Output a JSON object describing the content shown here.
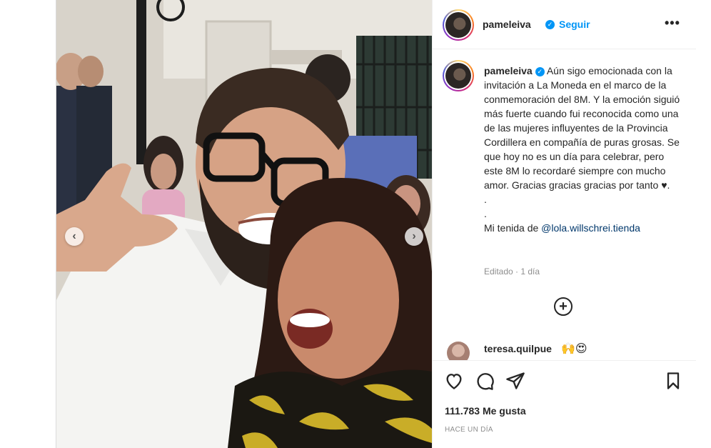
{
  "header": {
    "username": "pameleiva",
    "verified_icon": "verified-badge-icon",
    "separator": "•",
    "follow_label": "Seguir",
    "more_label": "•••"
  },
  "caption": {
    "username": "pameleiva",
    "text": "Aún sigo emocionada con la invitación a La Moneda en el marco de la conmemoración del 8M. Y la emoción siguió más fuerte cuando fui reconocida como una de las mujeres influyentes de la Provincia Cordillera en compañía de puras grosas. Se que hoy no es un día para celebrar, pero este 8M lo recordaré siempre con mucho amor. Gracias gracias gracias por tanto ♥.",
    "dot1": ".",
    "dot2": ".",
    "outfit_prefix": "Mi tenida de",
    "outfit_mention": "@lola.willschrei.tienda",
    "edited": "Editado",
    "time": "1 día"
  },
  "comment": {
    "username": "teresa.quilpue",
    "emojis": "🙌😍"
  },
  "actions": {
    "likes": "111.783 Me gusta",
    "posted": "HACE UN DÍA"
  },
  "carousel": {
    "prev_label": "‹",
    "next_label": "›"
  },
  "colors": {
    "accent": "#0095f6",
    "mention": "#00376b",
    "muted": "#8e8e8e",
    "text": "#262626"
  }
}
